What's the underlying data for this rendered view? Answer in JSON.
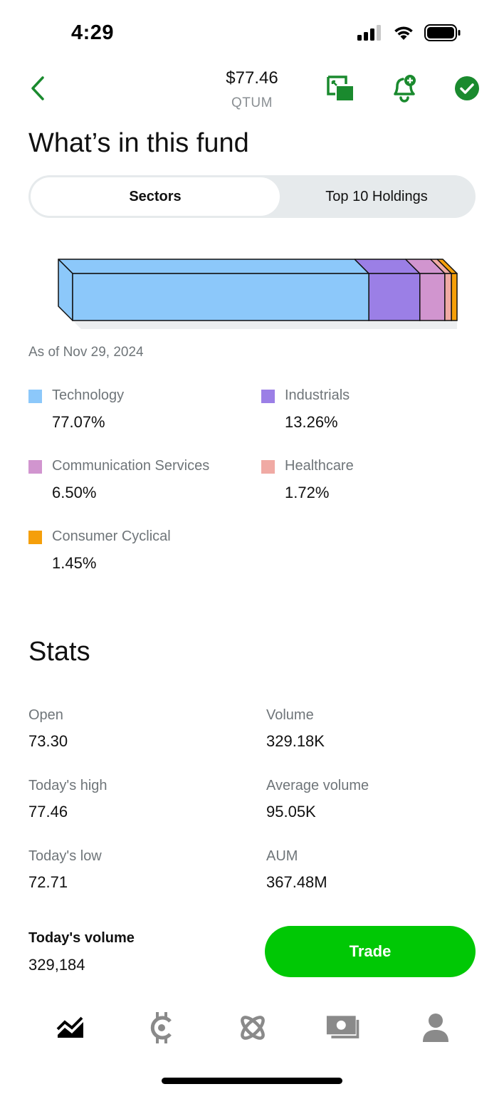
{
  "status_bar": {
    "time": "4:29"
  },
  "header": {
    "price": "$77.46",
    "symbol": "QTUM"
  },
  "fund": {
    "title": "What’s in this fund",
    "tabs": [
      {
        "label": "Sectors",
        "active": true
      },
      {
        "label": "Top 10 Holdings",
        "active": false
      }
    ],
    "as_of": "As of Nov 29, 2024",
    "sectors": [
      {
        "name": "Technology",
        "value": "77.07%",
        "pct": 77.07,
        "color": "#8cc8fa"
      },
      {
        "name": "Industrials",
        "value": "13.26%",
        "pct": 13.26,
        "color": "#9b7fe6"
      },
      {
        "name": "Communication Services",
        "value": "6.50%",
        "pct": 6.5,
        "color": "#d195cf"
      },
      {
        "name": "Healthcare",
        "value": "1.72%",
        "pct": 1.72,
        "color": "#f0aaa4"
      },
      {
        "name": "Consumer Cyclical",
        "value": "1.45%",
        "pct": 1.45,
        "color": "#f59f0a"
      }
    ]
  },
  "stats": {
    "title": "Stats",
    "items": [
      {
        "label": "Open",
        "value": "73.30"
      },
      {
        "label": "Volume",
        "value": "329.18K"
      },
      {
        "label": "Today's high",
        "value": "77.46"
      },
      {
        "label": "Average volume",
        "value": "95.05K"
      },
      {
        "label": "Today's low",
        "value": "72.71"
      },
      {
        "label": "AUM",
        "value": "367.48M"
      }
    ],
    "todays_volume_label": "Today's volume",
    "todays_volume_value": "329,184"
  },
  "actions": {
    "trade_label": "Trade"
  },
  "colors": {
    "brand_green": "#00c805",
    "icon_green": "#1a8a2e"
  },
  "tabbar": [
    "investing-icon",
    "browse-icon",
    "crypto-icon",
    "cash-icon",
    "account-icon"
  ]
}
